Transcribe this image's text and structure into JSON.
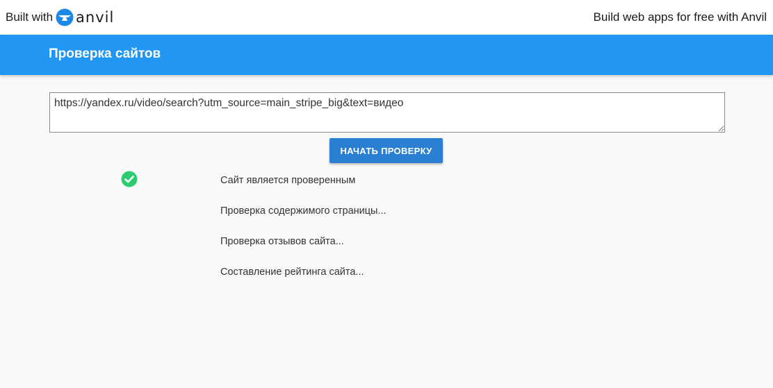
{
  "topbar": {
    "built_with": "Built with",
    "brand": "anvil",
    "right_link": "Build web apps for free with Anvil"
  },
  "appbar": {
    "title": "Проверка сайтов"
  },
  "main": {
    "url_value": "https://yandex.ru/video/search?utm_source=main_stripe_big&text=видео",
    "start_button": "НАЧАТЬ ПРОВЕРКУ",
    "statuses": [
      {
        "text": "Сайт является проверенным",
        "icon": "check-circle-icon"
      },
      {
        "text": "Проверка содержимого страницы..."
      },
      {
        "text": "Проверка отзывов сайта..."
      },
      {
        "text": "Составление рейтинга сайта..."
      }
    ]
  },
  "colors": {
    "appbar": "#2196f3",
    "button": "#2b7fd3",
    "check": "#2ecc71",
    "logo": "#1e88e5"
  }
}
